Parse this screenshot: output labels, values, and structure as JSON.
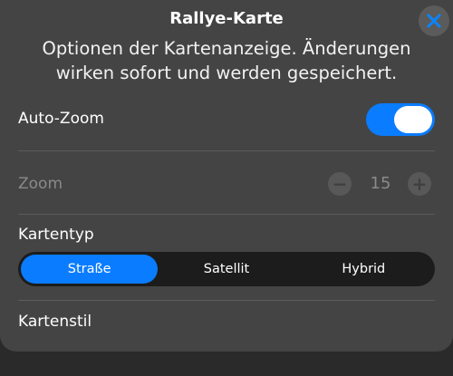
{
  "sheet": {
    "title": "Rallye-Karte",
    "description": "Optionen der Kartenanzeige. Änderungen wirken sofort und werden gespeichert.",
    "close_icon": "close-icon"
  },
  "auto_zoom": {
    "label": "Auto-Zoom",
    "enabled": true
  },
  "zoom": {
    "label": "Zoom",
    "value": "15",
    "decrement_symbol": "−",
    "increment_symbol": "+",
    "disabled": true
  },
  "map_type": {
    "label": "Kartentyp",
    "options": [
      "Straße",
      "Satellit",
      "Hybrid"
    ],
    "selected": "Straße"
  },
  "map_style": {
    "label": "Kartenstil"
  },
  "colors": {
    "accent": "#0a7cff",
    "sheet_background": "#444444",
    "segmented_background": "#1c1c1c"
  }
}
